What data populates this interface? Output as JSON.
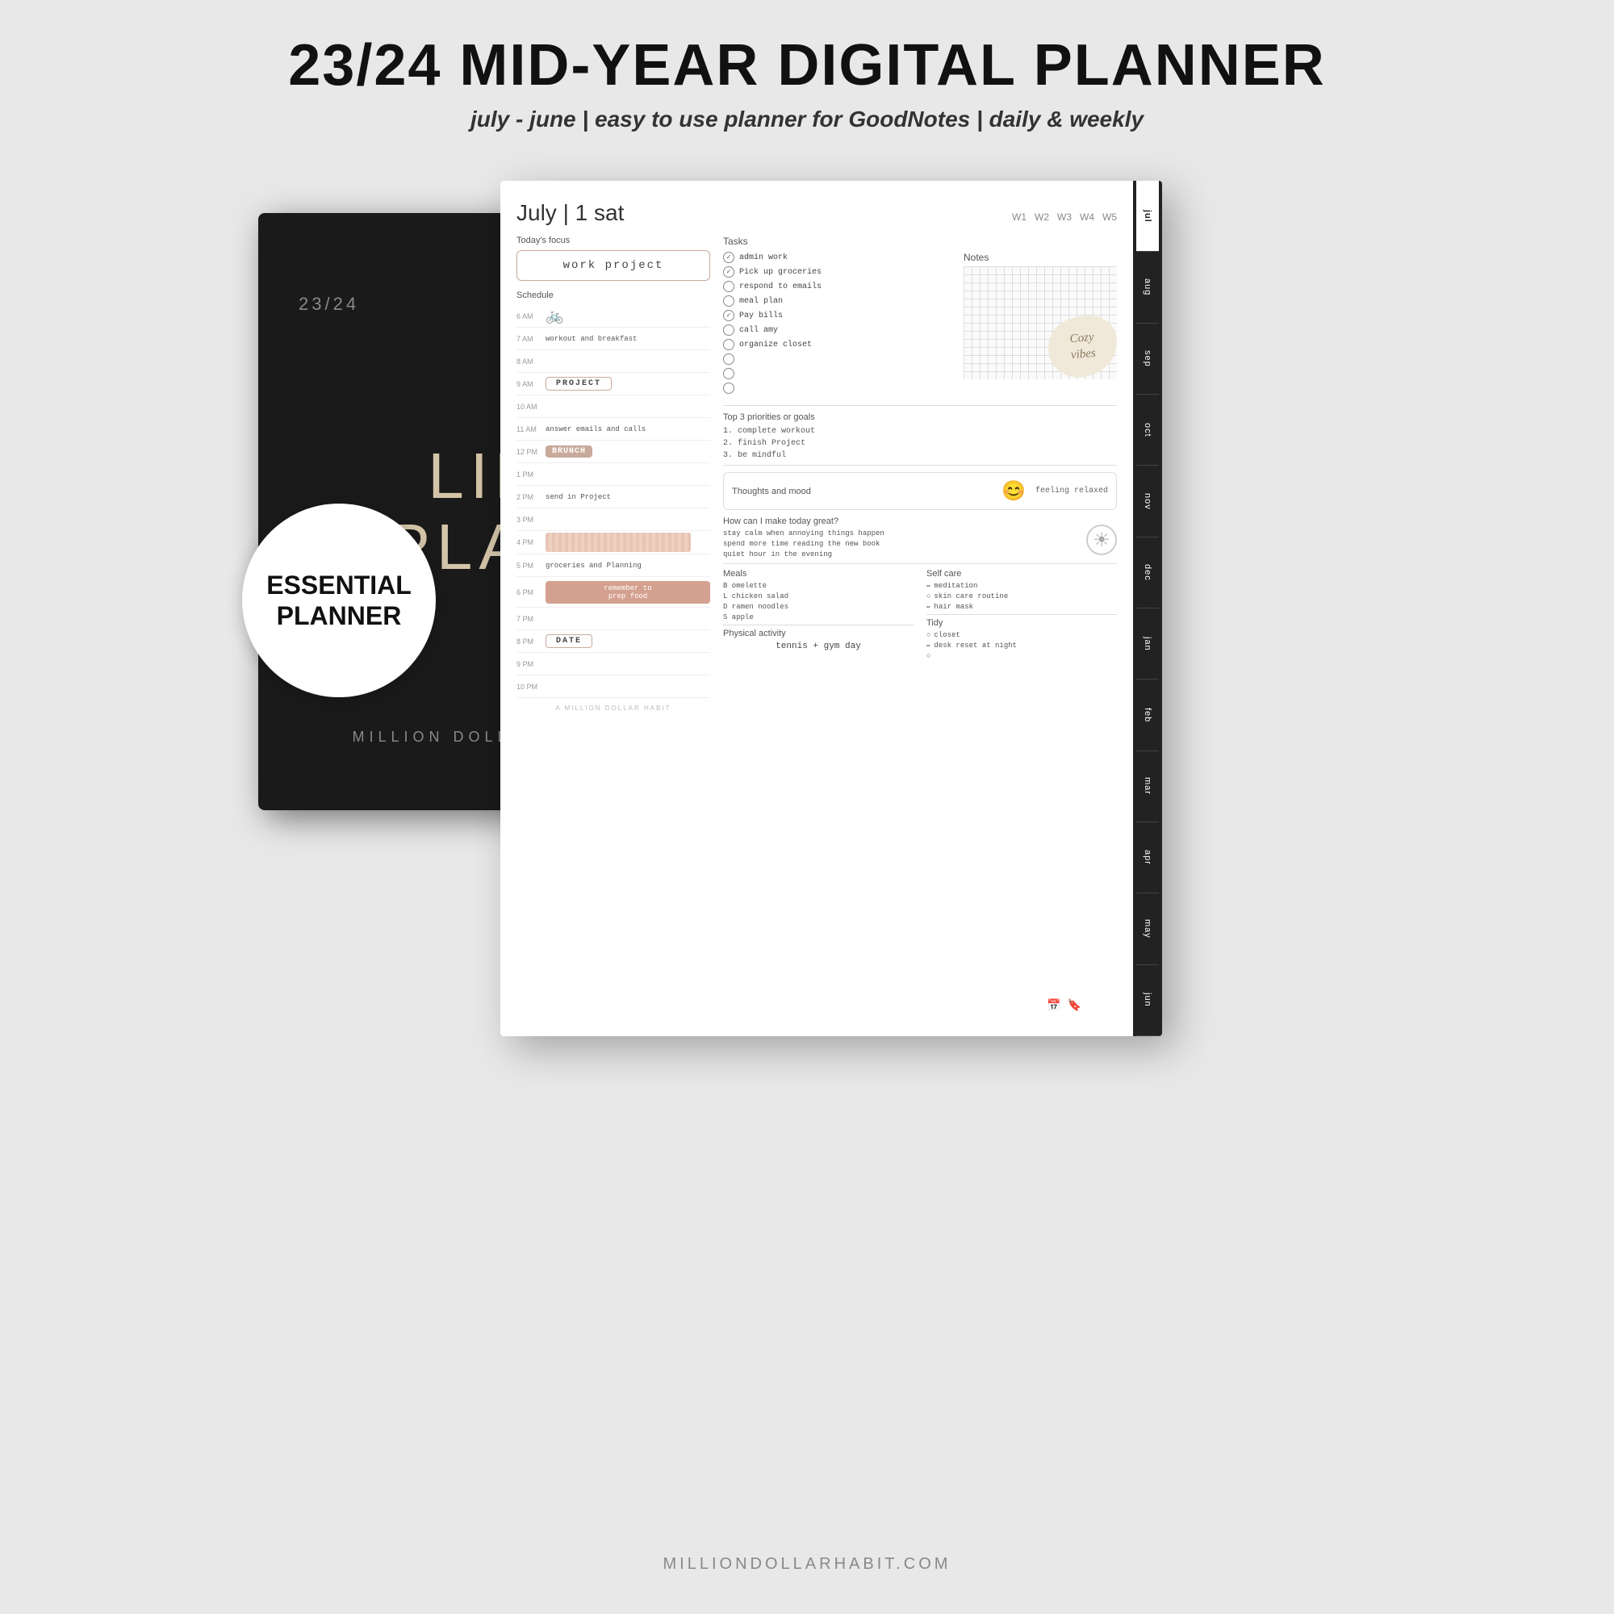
{
  "header": {
    "main_title": "23/24 MID-YEAR DIGITAL PLANNER",
    "subtitle_bold": "july - june",
    "subtitle_rest": " | easy to use planner for GoodNotes | daily & weekly"
  },
  "badge": {
    "line1": "ESSENTIAL",
    "line2": "PLANNER"
  },
  "dark_notebook": {
    "year": "23/24",
    "title_line1": "LIF",
    "title_line2": "PLAN",
    "brand": "MILLION DOLLAR HABIT"
  },
  "planner_page": {
    "date": "July",
    "day_num": "1",
    "day_name": "sat",
    "week_nav": [
      "W1",
      "W2",
      "W3",
      "W4",
      "W5"
    ],
    "focus_label": "Today's focus",
    "focus_text": "work Project",
    "schedule_label": "Schedule",
    "schedule": [
      {
        "time": "6 AM",
        "content": "bike",
        "type": "icon"
      },
      {
        "time": "7 AM",
        "content": "workout and breakfast",
        "type": "text"
      },
      {
        "time": "8 AM",
        "content": "",
        "type": "empty"
      },
      {
        "time": "9 AM",
        "content": "PROJECT",
        "type": "box"
      },
      {
        "time": "10 AM",
        "content": "",
        "type": "empty"
      },
      {
        "time": "11 AM",
        "content": "answer emails and calls",
        "type": "text"
      },
      {
        "time": "12 PM",
        "content": "BRUNCH",
        "type": "filled"
      },
      {
        "time": "1 PM",
        "content": "",
        "type": "empty"
      },
      {
        "time": "2 PM",
        "content": "send in Project",
        "type": "text"
      },
      {
        "time": "3 PM",
        "content": "",
        "type": "empty"
      },
      {
        "time": "4 PM",
        "content": "bar",
        "type": "bar"
      },
      {
        "time": "5 PM",
        "content": "groceries and Planning",
        "type": "text"
      },
      {
        "time": "6 PM",
        "content": "remember to prep food",
        "type": "filled_text"
      },
      {
        "time": "7 PM",
        "content": "",
        "type": "empty"
      },
      {
        "time": "8 PM",
        "content": "DATE",
        "type": "box"
      },
      {
        "time": "9 PM",
        "content": "",
        "type": "empty"
      },
      {
        "time": "10 PM",
        "content": "",
        "type": "empty"
      }
    ],
    "tasks_label": "Tasks",
    "tasks": [
      {
        "text": "admin work",
        "checked": true
      },
      {
        "text": "Pick up groceries",
        "checked": true
      },
      {
        "text": "respond to emails",
        "checked": false
      },
      {
        "text": "meal plan",
        "checked": false
      },
      {
        "text": "Pay bills",
        "checked": true
      },
      {
        "text": "call amy",
        "checked": false
      },
      {
        "text": "organize closet",
        "checked": false
      },
      {
        "text": "",
        "checked": false
      },
      {
        "text": "",
        "checked": false
      },
      {
        "text": "",
        "checked": false
      }
    ],
    "notes_label": "Notes",
    "cozy_sticker": "Cozy\nvibes",
    "priorities_label": "Top 3 priorities or goals",
    "priorities": [
      "1. complete workout",
      "2. finish Project",
      "3. be mindful"
    ],
    "mood_label": "Thoughts and mood",
    "mood_text": "feeling relaxed",
    "make_great_label": "How can I make today great?",
    "make_great_items": [
      "stay calm when annoying things happen",
      "spend more time reading the new book",
      "quiet hour in the evening"
    ],
    "meals_label": "Meals",
    "meals": [
      "B  omelette",
      "L  chicken salad",
      "D  ramen noodles",
      "S  apple"
    ],
    "selfcare_label": "Self care",
    "selfcare_items": [
      {
        "text": "meditation",
        "icon": "✏"
      },
      {
        "text": "skin care routine",
        "icon": "○"
      },
      {
        "text": "hair mask",
        "icon": "✏"
      }
    ],
    "physical_label": "Physical activity",
    "physical_text": "tennis + gym day",
    "tidy_label": "Tidy",
    "tidy_items": [
      {
        "text": "closet",
        "icon": "○"
      },
      {
        "text": "desk reset at night",
        "icon": "✏"
      },
      {
        "text": "",
        "icon": "○"
      }
    ],
    "months": [
      "jul",
      "aug",
      "sep",
      "oct",
      "nov",
      "dec",
      "jan",
      "feb",
      "mar",
      "apr",
      "may",
      "jun"
    ]
  },
  "footer": {
    "brand": "MILLIONDOLLARHABIT.COM"
  }
}
